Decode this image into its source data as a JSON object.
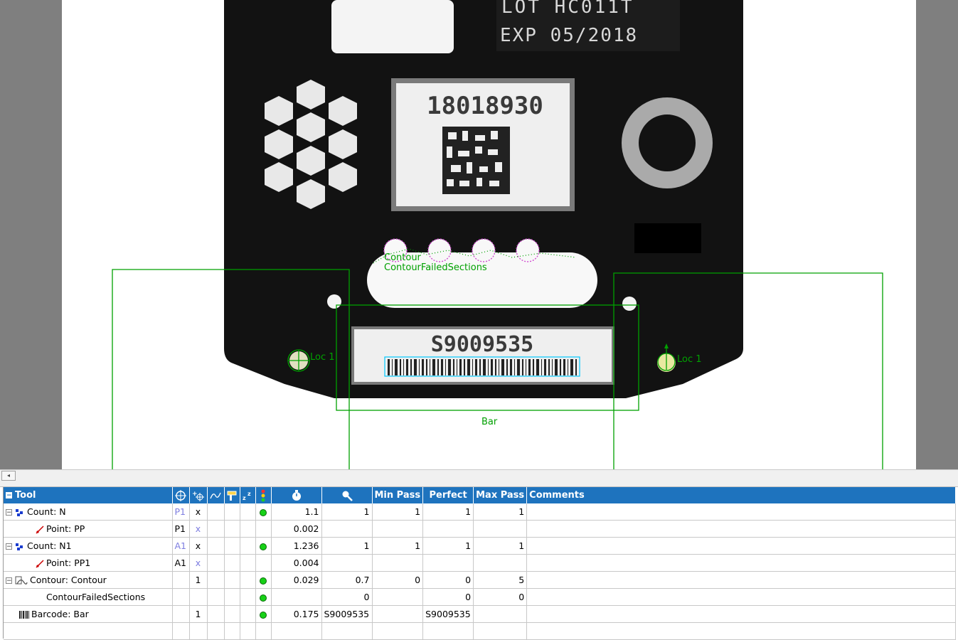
{
  "image": {
    "lot_text": "LOT HC011T",
    "exp_text": "EXP 05/2018",
    "label_number": "18018930",
    "barcode_label_text": "S9009535"
  },
  "overlays": {
    "contour_label": "Contour",
    "contour_failed_label": "ContourFailedSections",
    "loc_left_label": "Loc 1",
    "loc_right_label": "Loc 1",
    "bar_label": "Bar",
    "overlay_color": "#00a000",
    "barcode_box_color": "#00c8ff"
  },
  "scrollbar": {
    "left_arrow": "◂"
  },
  "grid": {
    "header_color": "#1e73be",
    "status_color": "#17d117",
    "columns": {
      "tool": "Tool",
      "min_pass": "Min Pass",
      "perfect": "Perfect",
      "max_pass": "Max Pass",
      "comments": "Comments"
    },
    "header_icons": [
      "crosshair-icon",
      "add-point-icon",
      "line-icon",
      "tool-icon",
      "sort-icon",
      "status-light-icon",
      "stopwatch-icon",
      "magnifier-icon"
    ],
    "rows": [
      {
        "tool": "Count: N",
        "icon": "count-icon",
        "ref": "P1",
        "x": "x",
        "time": "1.1",
        "result": "1",
        "min": "1",
        "perfect": "1",
        "max": "1"
      },
      {
        "tool": "Point: PP",
        "icon": "point-icon",
        "ref": "P1",
        "x": "x",
        "time": "0.002",
        "result": "",
        "min": "",
        "perfect": "",
        "max": ""
      },
      {
        "tool": "Count: N1",
        "icon": "count-icon",
        "ref": "A1",
        "x": "x",
        "time": "1.236",
        "result": "1",
        "min": "1",
        "perfect": "1",
        "max": "1"
      },
      {
        "tool": "Point: PP1",
        "icon": "point-icon",
        "ref": "A1",
        "x": "x",
        "time": "0.004",
        "result": "",
        "min": "",
        "perfect": "",
        "max": ""
      },
      {
        "tool": "Contour: Contour",
        "icon": "contour-icon",
        "ref": "",
        "x": "1",
        "time": "0.029",
        "result": "0.7",
        "min": "0",
        "perfect": "0",
        "max": "5"
      },
      {
        "tool": "ContourFailedSections",
        "icon": "",
        "ref": "",
        "x": "",
        "time": "",
        "result": "0",
        "min": "",
        "perfect": "0",
        "max": "0"
      },
      {
        "tool": "Barcode: Bar",
        "icon": "barcode-icon",
        "ref": "",
        "x": "1",
        "time": "0.175",
        "result": "S9009535",
        "min": "",
        "perfect": "S9009535",
        "max": ""
      }
    ]
  }
}
